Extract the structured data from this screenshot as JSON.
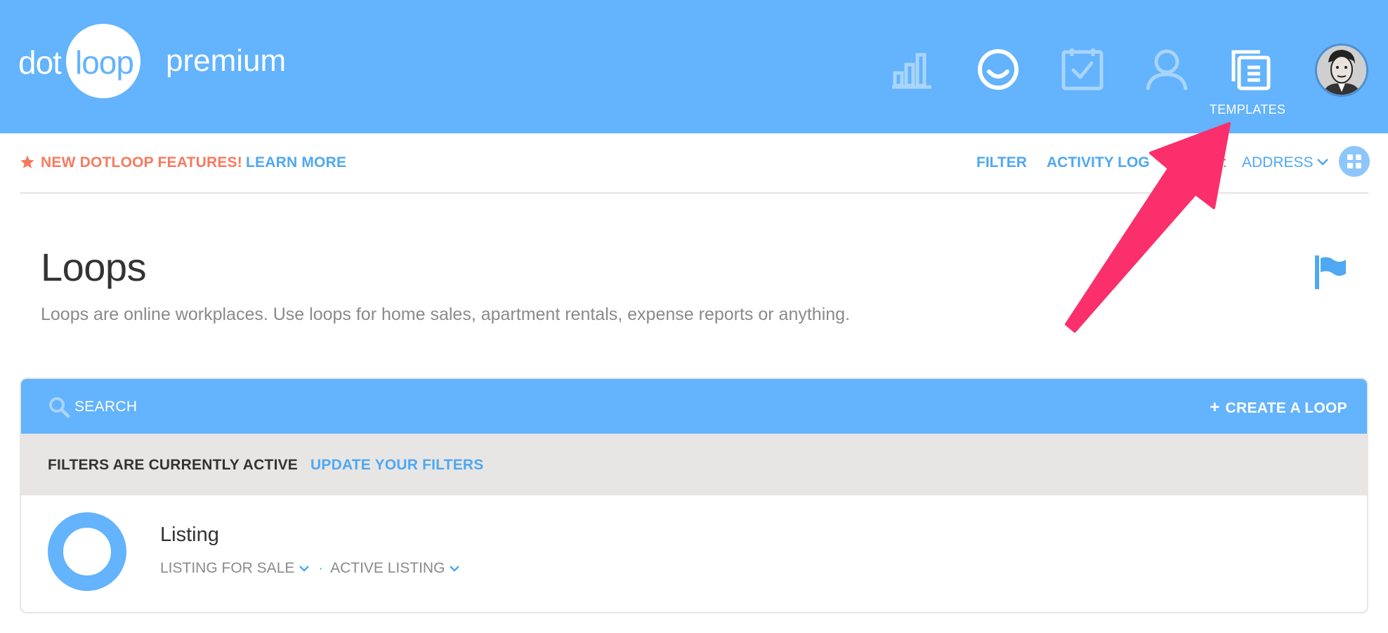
{
  "header": {
    "logo": {
      "dot": "dot",
      "loop": "loop",
      "premium": "premium"
    },
    "nav_icons": [
      "reports-icon",
      "dotloop-smile-icon",
      "tasks-icon",
      "profile-icon",
      "templates-icon"
    ],
    "templates_label": "TEMPLATES",
    "avatar_icon": "user-avatar"
  },
  "subbar": {
    "new_features": "NEW DOTLOOP FEATURES!",
    "learn_more": "LEARN MORE",
    "filter": "FILTER",
    "activity_log": "ACTIVITY LOG",
    "sort_by_label": "Y:",
    "sort_by_value": "ADDRESS"
  },
  "page": {
    "title": "Loops",
    "subtitle": "Loops are online workplaces. Use loops for home sales, apartment rentals, expense reports or anything."
  },
  "loops_panel": {
    "search_placeholder": "SEARCH",
    "create_loop": "CREATE A LOOP",
    "filters_active": "FILTERS ARE CURRENTLY ACTIVE",
    "update_filters": "UPDATE YOUR FILTERS",
    "loops": [
      {
        "name": "Listing",
        "type": "LISTING FOR SALE",
        "status": "ACTIVE LISTING"
      }
    ]
  },
  "colors": {
    "brand_blue": "#63b3fd",
    "link_blue": "#4ea8f2",
    "feature_orange": "#f77a5f",
    "annotation_pink": "#fb2f6b",
    "filters_bg": "#e8e6e4"
  }
}
